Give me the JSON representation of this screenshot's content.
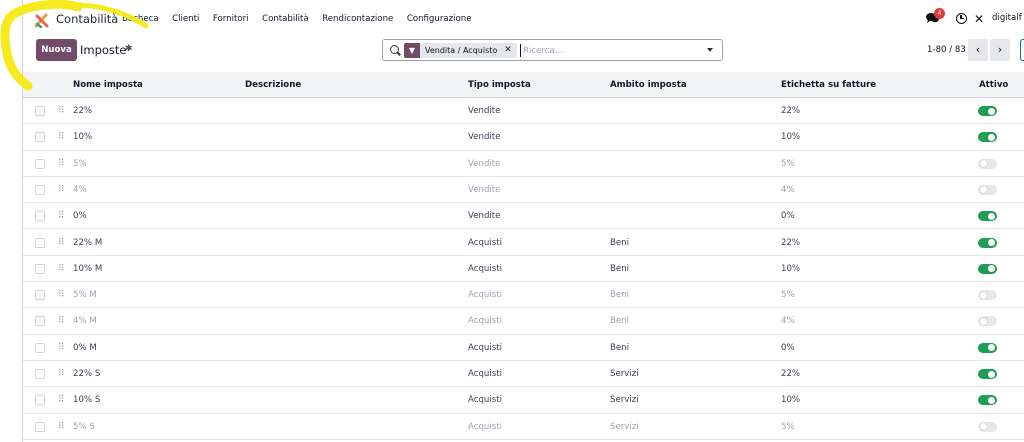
{
  "navbar": {
    "app_name": "Contabilità",
    "menu": [
      "Bacheca",
      "Clienti",
      "Fornitori",
      "Contabilità",
      "Rendicontazione",
      "Configurazione"
    ],
    "messages_badge": "4",
    "user_name": "digitalf"
  },
  "control_panel": {
    "new_button_label": "Nuova",
    "title": "Imposte",
    "filter_facet": "Vendita / Acquisto",
    "search_placeholder": "Ricerca...",
    "pager_value": "1-80 / 83",
    "pager_prev": "‹",
    "pager_next": "›"
  },
  "table": {
    "headers": {
      "name": "Nome imposta",
      "description": "Descrizione",
      "type": "Tipo imposta",
      "scope": "Ambito imposta",
      "invoice_label": "Etichetta su fatture",
      "active": "Attivo"
    },
    "rows": [
      {
        "name": "22%",
        "description": "",
        "type": "Vendite",
        "scope": "",
        "invoice_label": "22%",
        "active": true
      },
      {
        "name": "10%",
        "description": "",
        "type": "Vendite",
        "scope": "",
        "invoice_label": "10%",
        "active": true
      },
      {
        "name": "5%",
        "description": "",
        "type": "Vendite",
        "scope": "",
        "invoice_label": "5%",
        "active": false
      },
      {
        "name": "4%",
        "description": "",
        "type": "Vendite",
        "scope": "",
        "invoice_label": "4%",
        "active": false
      },
      {
        "name": "0%",
        "description": "",
        "type": "Vendite",
        "scope": "",
        "invoice_label": "0%",
        "active": true
      },
      {
        "name": "22% M",
        "description": "",
        "type": "Acquisti",
        "scope": "Beni",
        "invoice_label": "22%",
        "active": true
      },
      {
        "name": "10% M",
        "description": "",
        "type": "Acquisti",
        "scope": "Beni",
        "invoice_label": "10%",
        "active": true
      },
      {
        "name": "5% M",
        "description": "",
        "type": "Acquisti",
        "scope": "Beni",
        "invoice_label": "5%",
        "active": false
      },
      {
        "name": "4% M",
        "description": "",
        "type": "Acquisti",
        "scope": "Beni",
        "invoice_label": "4%",
        "active": false
      },
      {
        "name": "0% M",
        "description": "",
        "type": "Acquisti",
        "scope": "Beni",
        "invoice_label": "0%",
        "active": true
      },
      {
        "name": "22% S",
        "description": "",
        "type": "Acquisti",
        "scope": "Servizi",
        "invoice_label": "22%",
        "active": true
      },
      {
        "name": "10% S",
        "description": "",
        "type": "Acquisti",
        "scope": "Servizi",
        "invoice_label": "10%",
        "active": true
      },
      {
        "name": "5% S",
        "description": "",
        "type": "Acquisti",
        "scope": "Servizi",
        "invoice_label": "5%",
        "active": false
      }
    ]
  },
  "colors": {
    "brand": "#714b67",
    "toggle_on": "#1f9d55",
    "highlight": "#f5ea14"
  }
}
